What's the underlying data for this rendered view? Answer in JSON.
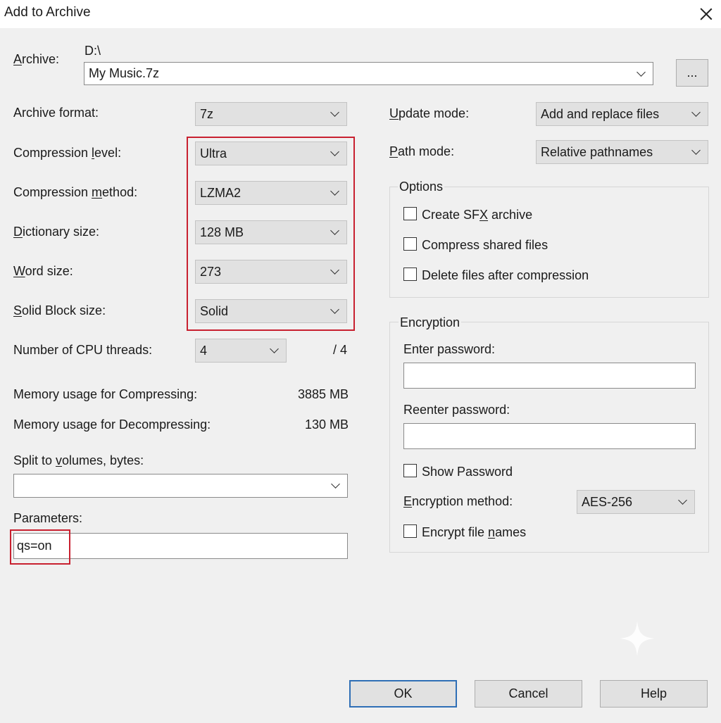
{
  "window": {
    "title": "Add to Archive"
  },
  "archive": {
    "label_pre": "",
    "label_u": "A",
    "label_post": "rchive:",
    "path": "D:\\",
    "name": "My Music.7z",
    "browse_label": "..."
  },
  "left": {
    "archive_format": {
      "label": "Archive format:",
      "value": "7z"
    },
    "compression_level": {
      "label_pre": "Compression ",
      "label_u": "l",
      "label_post": "evel:",
      "value": "Ultra"
    },
    "compression_method": {
      "label_pre": "Compression ",
      "label_u": "m",
      "label_post": "ethod:",
      "value": "LZMA2"
    },
    "dictionary_size": {
      "label_pre": "",
      "label_u": "D",
      "label_post": "ictionary size:",
      "value": "128 MB"
    },
    "word_size": {
      "label_pre": "",
      "label_u": "W",
      "label_post": "ord size:",
      "value": "273"
    },
    "solid_block_size": {
      "label_pre": "",
      "label_u": "S",
      "label_post": "olid Block size:",
      "value": "Solid"
    },
    "cpu_threads": {
      "label": "Number of CPU threads:",
      "value": "4",
      "max": "/ 4"
    },
    "memory_compress": {
      "label": "Memory usage for Compressing:",
      "value": "3885 MB"
    },
    "memory_decompress": {
      "label": "Memory usage for Decompressing:",
      "value": "130 MB"
    },
    "split_volumes": {
      "label_pre": "Split to ",
      "label_u": "v",
      "label_post": "olumes, bytes:",
      "value": ""
    },
    "parameters": {
      "label": "Parameters:",
      "value": "qs=on"
    }
  },
  "right": {
    "update_mode": {
      "label_pre": "",
      "label_u": "U",
      "label_post": "pdate mode:",
      "value": "Add and replace files"
    },
    "path_mode": {
      "label_pre": "",
      "label_u": "P",
      "label_post": "ath mode:",
      "value": "Relative pathnames"
    },
    "options": {
      "title": "Options",
      "sfx": {
        "pre": "Create SF",
        "u": "X",
        "post": " archive"
      },
      "shared": {
        "pre": "Compress shared files",
        "u": "",
        "post": ""
      },
      "delete": {
        "pre": "Delete files after compression",
        "u": "",
        "post": ""
      }
    },
    "encryption": {
      "title": "Encryption",
      "enter_password": "Enter password:",
      "reenter_password": "Reenter password:",
      "show_password": "Show Password",
      "method_label_pre": "",
      "method_label_u": "E",
      "method_label_post": "ncryption method:",
      "method_value": "AES-256",
      "encrypt_names_pre": "Encrypt file ",
      "encrypt_names_u": "n",
      "encrypt_names_post": "ames"
    }
  },
  "buttons": {
    "ok": "OK",
    "cancel": "Cancel",
    "help": "Help"
  },
  "colors": {
    "highlight": "#c8202f",
    "default_button_border": "#2f6fb6"
  }
}
